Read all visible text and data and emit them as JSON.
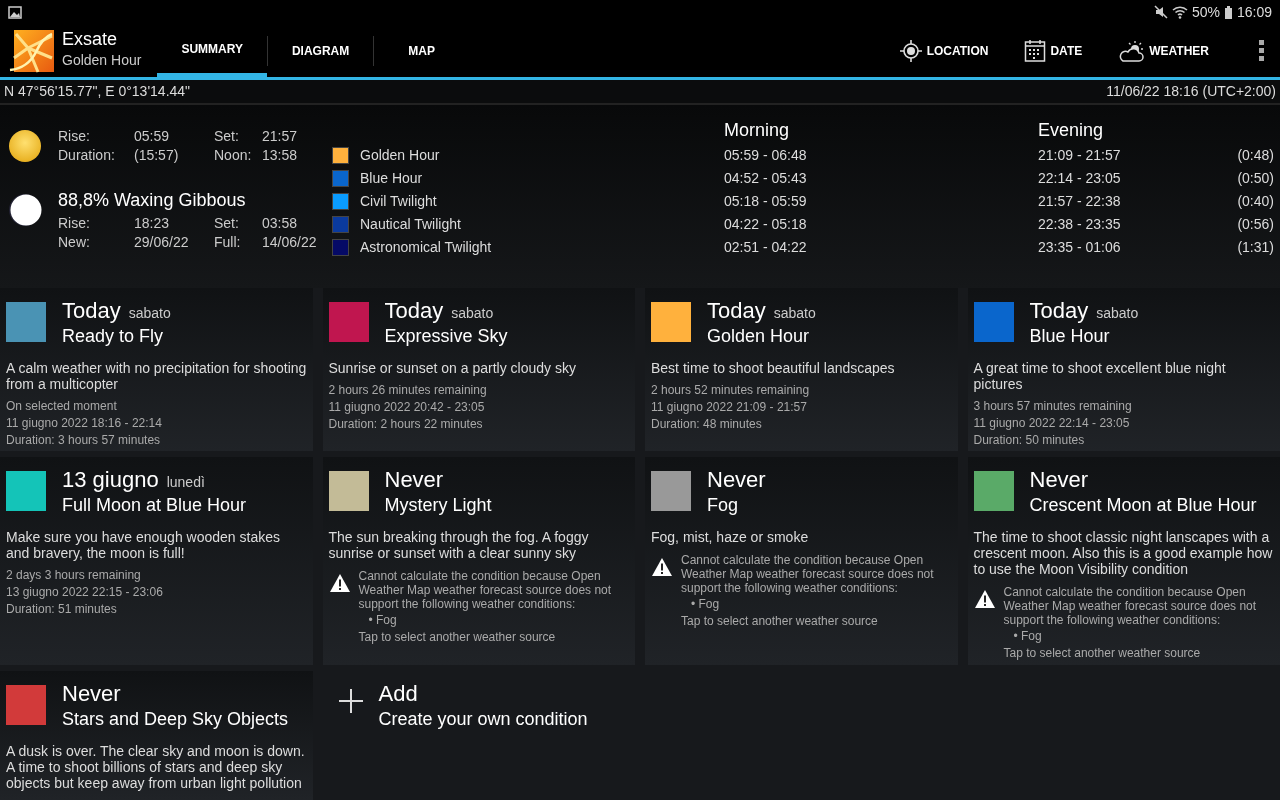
{
  "status_bar": {
    "battery": "50%",
    "time": "16:09",
    "muted": true
  },
  "app": {
    "name": "Exsate",
    "subtitle": "Golden Hour"
  },
  "tabs": [
    {
      "label": "SUMMARY",
      "selected": true
    },
    {
      "label": "DIAGRAM",
      "selected": false
    },
    {
      "label": "MAP",
      "selected": false
    }
  ],
  "actions": [
    {
      "kind": "location",
      "label": "LOCATION"
    },
    {
      "kind": "date",
      "label": "DATE"
    },
    {
      "kind": "weather",
      "label": "WEATHER"
    }
  ],
  "location_bar": {
    "coordinates": "N 47°56'15.77\", E 0°13'14.44\"",
    "datetime": "11/06/22 18:16 (UTC+2:00)"
  },
  "sun": {
    "fields": [
      {
        "label": "Rise:",
        "value": "05:59"
      },
      {
        "label": "Set:",
        "value": "21:57"
      },
      {
        "label": "Duration:",
        "value": "(15:57)"
      },
      {
        "label": "Noon:",
        "value": "13:58"
      }
    ]
  },
  "moon": {
    "phase": "88,8% Waxing Gibbous",
    "fields": [
      {
        "label": "Rise:",
        "value": "18:23"
      },
      {
        "label": "Set:",
        "value": "03:58"
      },
      {
        "label": "New:",
        "value": "29/06/22"
      },
      {
        "label": "Full:",
        "value": "14/06/22"
      }
    ]
  },
  "periods": {
    "morning_heading": "Morning",
    "evening_heading": "Evening",
    "items": [
      {
        "label": "Golden Hour",
        "color": "#ffb13d",
        "morning": "05:59 - 06:48",
        "evening": "21:09 - 21:57",
        "duration": "(0:48)"
      },
      {
        "label": "Blue Hour",
        "color": "#0a66cc",
        "morning": "04:52 - 05:43",
        "evening": "22:14 - 23:05",
        "duration": "(0:50)"
      },
      {
        "label": "Civil Twilight",
        "color": "#0a9cff",
        "morning": "05:18 - 05:59",
        "evening": "21:57 - 22:38",
        "duration": "(0:40)"
      },
      {
        "label": "Nautical Twilight",
        "color": "#0a3a9e",
        "morning": "04:22 - 05:18",
        "evening": "22:38 - 23:35",
        "duration": "(0:56)"
      },
      {
        "label": "Astronomical Twilight",
        "color": "#050a66",
        "morning": "02:51 - 04:22",
        "evening": "23:35 - 01:06",
        "duration": "(1:31)"
      }
    ]
  },
  "cards": [
    {
      "kind": "condition",
      "color": "#4a93b4",
      "when": "Today",
      "weekday": "sabato",
      "title": "Ready to Fly",
      "description": "A calm weather with no precipitation for shooting from a multicopter",
      "details": [
        "On selected moment",
        "11 giugno 2022 18:16 - 22:14",
        "Duration: 3 hours 57 minutes"
      ]
    },
    {
      "kind": "condition",
      "color": "#c0164f",
      "when": "Today",
      "weekday": "sabato",
      "title": "Expressive Sky",
      "description": "Sunrise or sunset on a partly cloudy sky",
      "details": [
        "2 hours 26 minutes remaining",
        "11 giugno 2022 20:42 - 23:05",
        "Duration: 2 hours 22 minutes"
      ]
    },
    {
      "kind": "condition",
      "color": "#ffb13d",
      "when": "Today",
      "weekday": "sabato",
      "title": "Golden Hour",
      "description": "Best time to shoot beautiful landscapes",
      "details": [
        "2 hours 52 minutes remaining",
        "11 giugno 2022 21:09 - 21:57",
        "Duration: 48 minutes"
      ]
    },
    {
      "kind": "condition",
      "color": "#0a66cc",
      "when": "Today",
      "weekday": "sabato",
      "title": "Blue Hour",
      "description": "A great time to shoot excellent blue night pictures",
      "details": [
        "3 hours 57 minutes remaining",
        "11 giugno 2022 22:14 - 23:05",
        "Duration: 50 minutes"
      ]
    },
    {
      "kind": "condition",
      "color": "#14c4b8",
      "when": "13 giugno",
      "weekday": "lunedì",
      "title": "Full Moon at Blue Hour",
      "description": "Make sure you have enough wooden stakes and bravery, the moon is full!",
      "details": [
        "2 days 3 hours remaining",
        "13 giugno 2022 22:15 - 23:06",
        "Duration: 51 minutes"
      ]
    },
    {
      "kind": "condition",
      "color": "#c3bb97",
      "when": "Never",
      "title": "Mystery Light",
      "description": "The sun breaking through the fog. A foggy sunrise or sunset with a clear sunny sky",
      "warning": {
        "message": "Cannot calculate the condition because Open Weather Map weather forecast source does not support the following weather conditions:",
        "bullet": "• Fog",
        "hint": "Tap to select another weather source"
      }
    },
    {
      "kind": "condition",
      "color": "#999999",
      "when": "Never",
      "title": "Fog",
      "description": "Fog, mist, haze or smoke",
      "warning": {
        "message": "Cannot calculate the condition because Open Weather Map weather forecast source does not support the following weather conditions:",
        "bullet": "• Fog",
        "hint": "Tap to select another weather source"
      }
    },
    {
      "kind": "condition",
      "color": "#5aaa68",
      "when": "Never",
      "title": "Crescent Moon at Blue Hour",
      "description": "The time to shoot classic night lanscapes with a crescent moon. Also this is a good example how to use the Moon Visibility condition",
      "warning": {
        "message": "Cannot calculate the condition because Open Weather Map weather forecast source does not support the following weather conditions:",
        "bullet": "• Fog",
        "hint": "Tap to select another weather source"
      }
    },
    {
      "kind": "condition",
      "color": "#d23a3a",
      "when": "Never",
      "title": "Stars and Deep Sky Objects",
      "description": "A dusk is over. The clear sky and moon is down. A time to shoot billions of stars and deep sky objects but keep away from urban light pollution"
    },
    {
      "kind": "add",
      "when": "Add",
      "title": "Create your own condition"
    }
  ]
}
